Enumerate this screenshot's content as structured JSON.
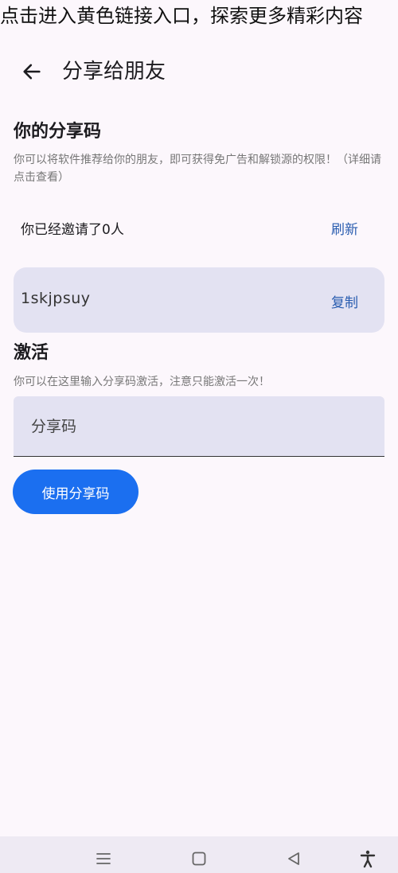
{
  "overlay": {
    "banner_text": "点击进入黄色链接入口，探索更多精彩内容"
  },
  "appbar": {
    "title": "分享给朋友",
    "back_icon": "arrow-left-icon"
  },
  "share_section": {
    "title": "你的分享码",
    "description": "你可以将软件推荐给你的朋友，即可获得免广告和解锁源的权限！（详细请点击查看）",
    "invite_status": "你已经邀请了0人",
    "refresh_label": "刷新",
    "code": "1skjpsuy",
    "copy_label": "复制"
  },
  "activate_section": {
    "title": "激活",
    "description": "你可以在这里输入分享码激活，注意只能激活一次！",
    "input_placeholder": "分享码",
    "input_value": "",
    "submit_label": "使用分享码"
  },
  "navbar": {
    "icons": [
      "menu-icon",
      "home-square-icon",
      "back-triangle-icon",
      "accessibility-icon"
    ]
  },
  "colors": {
    "background": "#fcf7fc",
    "card": "#e3e2f2",
    "accent_text": "#2a5db0",
    "primary_button": "#1b6ff0"
  }
}
